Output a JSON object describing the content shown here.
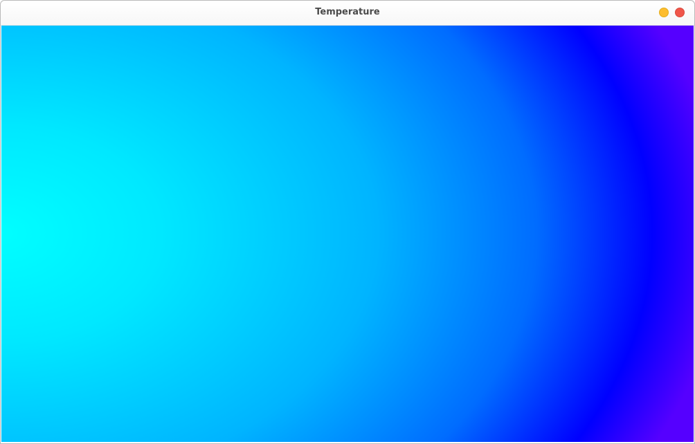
{
  "window": {
    "title": "Temperature",
    "buttons": {
      "minimize_color": "#fdbd2f",
      "close_color": "#f0564a"
    }
  },
  "heatmap": {
    "colormap": [
      "#00ffff",
      "#00e8ff",
      "#00b4ff",
      "#006cff",
      "#0000ff",
      "#5500ff"
    ],
    "description_colors": {
      "cold_left": "#00ffff",
      "mid": "#00b8ff",
      "edge": "#0000ff",
      "corner": "#5a00ff"
    }
  }
}
